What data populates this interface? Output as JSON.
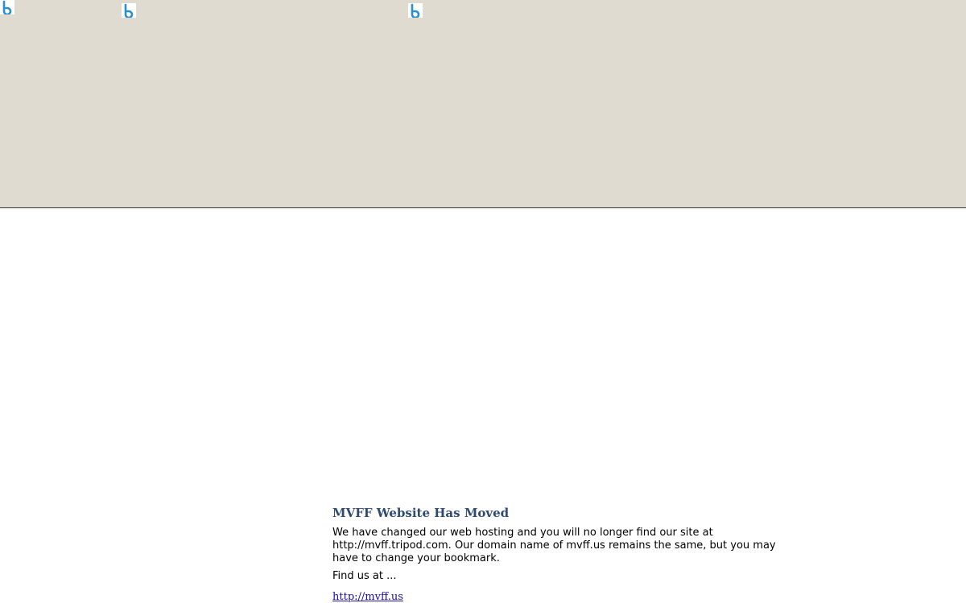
{
  "banner": {
    "background": "#dfdbd0",
    "icons": [
      "broken-image-icon",
      "broken-image-icon",
      "broken-image-icon"
    ]
  },
  "notice": {
    "title": "MVFF Website Has Moved",
    "body": "We have changed our web hosting and you will no longer find our site at http://mvff.tripod.com. Our domain name of mvff.us remains the same, but you may have to change your bookmark.",
    "find_us": "Find us at ...",
    "link_text": "http://mvff.us"
  },
  "colors": {
    "title": "#2e4a73",
    "link": "#1a0dab",
    "icon": "#2a8fd0"
  }
}
